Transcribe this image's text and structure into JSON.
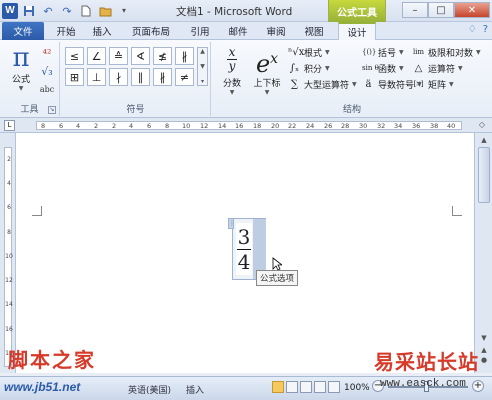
{
  "window": {
    "title": "文档1 - Microsoft Word",
    "context_title": "公式工具",
    "controls": [
      "–",
      "□",
      "✕"
    ]
  },
  "qat": {
    "icons": [
      "word-icon",
      "save-icon",
      "undo-icon",
      "redo-icon",
      "new-doc-icon",
      "open-folder-icon",
      "customize-icon"
    ],
    "glyphs": [
      "W",
      "💾",
      "↶",
      "↷",
      "▯",
      "▰",
      "▾"
    ]
  },
  "tabs": [
    {
      "label": "文件"
    },
    {
      "label": "开始"
    },
    {
      "label": "插入"
    },
    {
      "label": "页面布局"
    },
    {
      "label": "引用"
    },
    {
      "label": "邮件"
    },
    {
      "label": "审阅"
    },
    {
      "label": "视图"
    },
    {
      "label": "设计"
    }
  ],
  "tabs_right": [
    "♢",
    "?"
  ],
  "ribbon": {
    "tools": {
      "label": "工具",
      "equation_label": "公式",
      "equation_glyph": "π",
      "small_icons": [
        "⁴²",
        "√₃",
        "abc"
      ]
    },
    "symbols": {
      "label": "符号",
      "cells": [
        "≤",
        "∠",
        "≙",
        "∢",
        "≰",
        "∦",
        "⊞",
        "⊥",
        "∤",
        "∥",
        "∦",
        "≠"
      ]
    },
    "structures": {
      "label": "结构",
      "fraction_label": "分数",
      "script_label": "上下标",
      "items_col1": [
        {
          "icon": "ⁿ√x",
          "label": "根式"
        },
        {
          "icon": "∫ₓ",
          "label": "积分"
        },
        {
          "icon": "∑",
          "label": "大型运算符"
        }
      ],
      "items_col2": [
        {
          "icon": "{()}",
          "label": "括号"
        },
        {
          "icon": "sin θ",
          "label": "函数"
        },
        {
          "icon": "ä",
          "label": "导数符号"
        }
      ],
      "items_col3": [
        {
          "icon": "lim",
          "label": "极限和对数"
        },
        {
          "icon": "△",
          "label": "运算符"
        },
        {
          "icon": "[∷]",
          "label": "矩阵"
        }
      ]
    }
  },
  "ruler": {
    "corner": "L",
    "numbers": [
      "8",
      "6",
      "4",
      "2",
      "2",
      "4",
      "6",
      "8",
      "10",
      "12",
      "14",
      "16",
      "18",
      "20",
      "22",
      "24",
      "26",
      "28",
      "30",
      "32",
      "34",
      "36",
      "38",
      "40"
    ]
  },
  "vruler": {
    "numbers": [
      "2",
      "4",
      "6",
      "8",
      "10",
      "12",
      "14",
      "16",
      "18"
    ]
  },
  "document": {
    "equation": {
      "numerator": "3",
      "denominator": "4",
      "handle": "⋮"
    },
    "tooltip": "公式选项"
  },
  "statusbar": {
    "language": "英语(美国)",
    "mode": "插入",
    "zoom": "100%"
  },
  "watermarks": {
    "left": "脚本之家",
    "left_url": "www.jb51.net",
    "right": "易采站长站",
    "right_url": "www.easck.com"
  }
}
